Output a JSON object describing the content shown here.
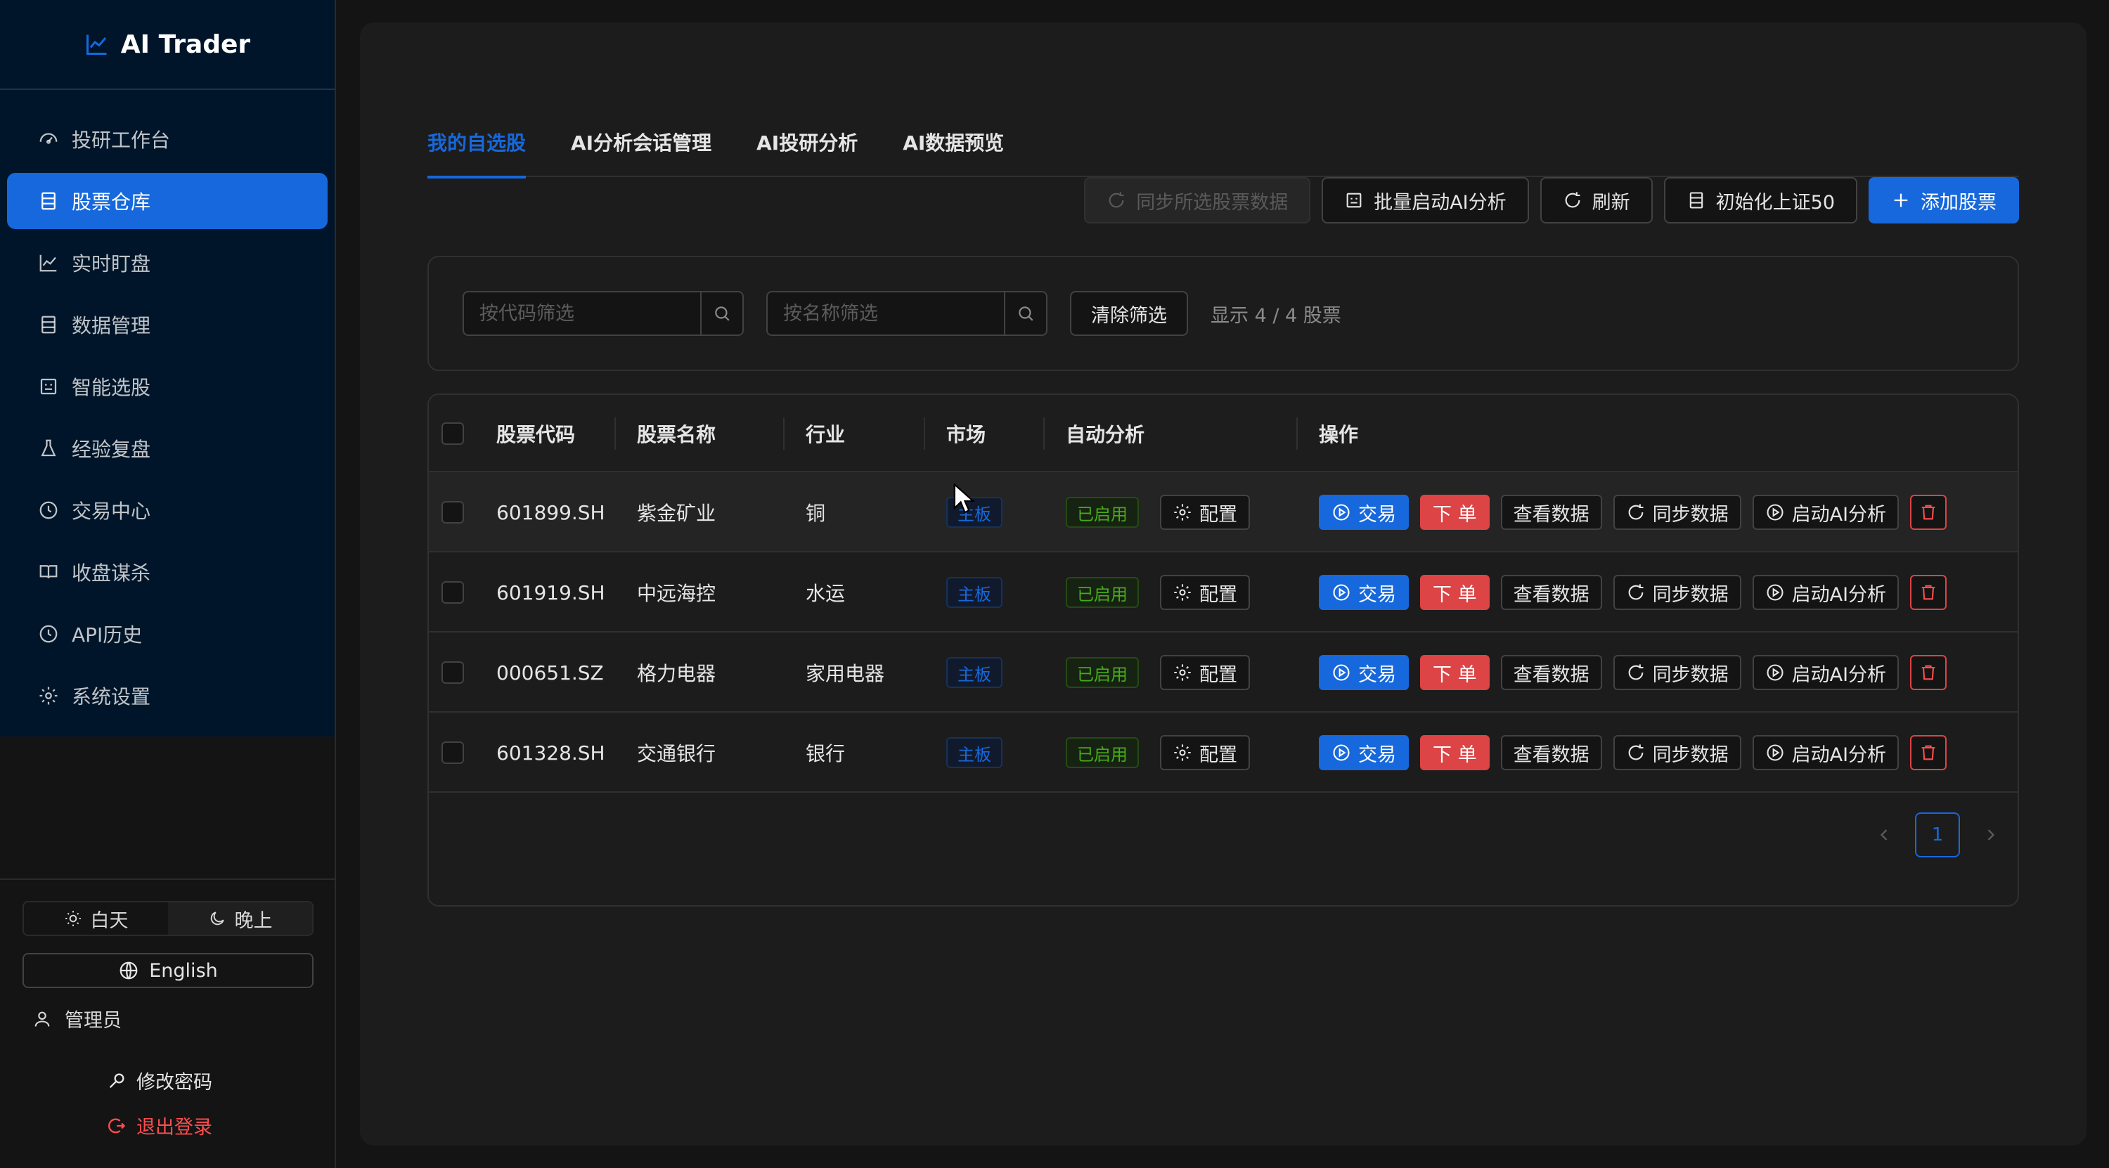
{
  "app": {
    "title": "AI Trader"
  },
  "sidebar": {
    "items": [
      {
        "label": "投研工作台",
        "icon": "dashboard-icon"
      },
      {
        "label": "股票仓库",
        "icon": "database-icon"
      },
      {
        "label": "实时盯盘",
        "icon": "line-chart-icon"
      },
      {
        "label": "数据管理",
        "icon": "database-icon"
      },
      {
        "label": "智能选股",
        "icon": "robot-icon"
      },
      {
        "label": "经验复盘",
        "icon": "experiment-icon"
      },
      {
        "label": "交易中心",
        "icon": "clock-icon"
      },
      {
        "label": "收盘谋杀",
        "icon": "book-icon"
      },
      {
        "label": "API历史",
        "icon": "history-icon"
      },
      {
        "label": "系统设置",
        "icon": "gear-icon"
      }
    ],
    "active_index": 1,
    "theme": {
      "day": "白天",
      "night": "晚上",
      "selected": "晚上"
    },
    "language_button": "English",
    "user": "管理员",
    "change_password": "修改密码",
    "logout": "退出登录"
  },
  "tabs": [
    {
      "label": "我的自选股",
      "active": true
    },
    {
      "label": "AI分析会话管理",
      "active": false
    },
    {
      "label": "AI投研分析",
      "active": false
    },
    {
      "label": "AI数据预览",
      "active": false
    }
  ],
  "toolbar": {
    "sync_selected": "同步所选股票数据",
    "batch_ai": "批量启动AI分析",
    "refresh": "刷新",
    "init_sse50": "初始化上证50",
    "add_stock": "添加股票"
  },
  "filters": {
    "code_placeholder": "按代码筛选",
    "name_placeholder": "按名称筛选",
    "clear": "清除筛选",
    "count_text": "显示 4 / 4 股票"
  },
  "table": {
    "columns": [
      "股票代码",
      "股票名称",
      "行业",
      "市场",
      "自动分析",
      "操作"
    ],
    "rows": [
      {
        "code": "601899.SH",
        "name": "紫金矿业",
        "industry": "铜",
        "market": "主板",
        "auto": "已启用"
      },
      {
        "code": "601919.SH",
        "name": "中远海控",
        "industry": "水运",
        "market": "主板",
        "auto": "已启用"
      },
      {
        "code": "000651.SZ",
        "name": "格力电器",
        "industry": "家用电器",
        "market": "主板",
        "auto": "已启用"
      },
      {
        "code": "601328.SH",
        "name": "交通银行",
        "industry": "银行",
        "market": "主板",
        "auto": "已启用"
      }
    ],
    "row_actions": {
      "config": "配置",
      "trade": "交易",
      "order": "下 单",
      "view_data": "查看数据",
      "sync_data": "同步数据",
      "start_ai": "启动AI分析"
    }
  },
  "pagination": {
    "current": "1"
  },
  "colors": {
    "accent": "#1668dc",
    "danger": "#dc4446",
    "success": "#49aa19",
    "sidebar_bg": "#001529",
    "page_bg": "#141414"
  }
}
